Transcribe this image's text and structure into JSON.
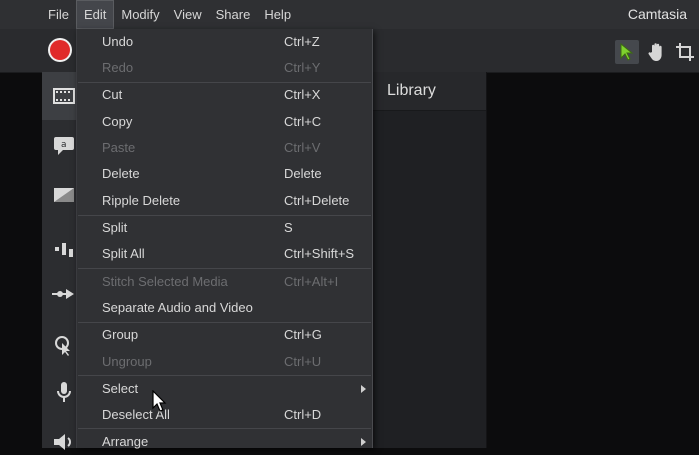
{
  "menubar": {
    "items": [
      "File",
      "Edit",
      "Modify",
      "View",
      "Share",
      "Help"
    ],
    "active": "Edit"
  },
  "app_title": "Camtasia",
  "library": {
    "title": "Library"
  },
  "edit_menu": {
    "items": [
      {
        "label": "Undo",
        "shortcut": "Ctrl+Z",
        "enabled": true
      },
      {
        "label": "Redo",
        "shortcut": "Ctrl+Y",
        "enabled": false
      },
      {
        "label": "Cut",
        "shortcut": "Ctrl+X",
        "enabled": true
      },
      {
        "label": "Copy",
        "shortcut": "Ctrl+C",
        "enabled": true
      },
      {
        "label": "Paste",
        "shortcut": "Ctrl+V",
        "enabled": false
      },
      {
        "label": "Delete",
        "shortcut": "Delete",
        "enabled": true
      },
      {
        "label": "Ripple Delete",
        "shortcut": "Ctrl+Delete",
        "enabled": true
      },
      {
        "label": "Split",
        "shortcut": "S",
        "enabled": true
      },
      {
        "label": "Split All",
        "shortcut": "Ctrl+Shift+S",
        "enabled": true
      },
      {
        "label": "Stitch Selected Media",
        "shortcut": "Ctrl+Alt+I",
        "enabled": false
      },
      {
        "label": "Separate Audio and Video",
        "shortcut": "",
        "enabled": true
      },
      {
        "label": "Group",
        "shortcut": "Ctrl+G",
        "enabled": true
      },
      {
        "label": "Ungroup",
        "shortcut": "Ctrl+U",
        "enabled": false
      },
      {
        "label": "Select",
        "shortcut": "",
        "enabled": true,
        "submenu": true
      },
      {
        "label": "Deselect All",
        "shortcut": "Ctrl+D",
        "enabled": true
      },
      {
        "label": "Arrange",
        "shortcut": "",
        "enabled": true,
        "submenu": true
      }
    ]
  },
  "colors": {
    "record": "#e02a2a",
    "menu_bg": "#303134",
    "disabled_text": "#6c6d70"
  },
  "icons": {
    "toolbar": [
      "record-icon",
      "select-arrow-icon",
      "pan-hand-icon",
      "crop-icon"
    ],
    "sidebar": [
      "media-icon",
      "annotations-icon",
      "transitions-icon",
      "behaviors-icon",
      "animations-icon",
      "cursor-effects-icon",
      "voice-narration-icon",
      "audio-effects-icon"
    ]
  }
}
